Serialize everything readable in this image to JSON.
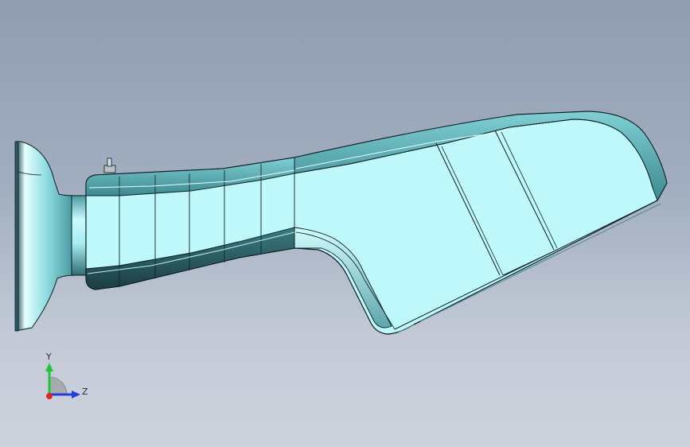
{
  "app": {
    "type": "cad-3d-viewport",
    "background_top": "#8f9db0",
    "background_bottom": "#cdd3dd"
  },
  "model": {
    "description_icon": "cad-part-icon",
    "face_color": "#bff8fb",
    "shade_color": "#3c7d80",
    "edge_color": "#0b1c22"
  },
  "triad": {
    "y_label": "Y",
    "z_label": "Z",
    "y_color": "#22c43a",
    "z_color": "#1f3fe0",
    "x_color": "#e0261c"
  }
}
